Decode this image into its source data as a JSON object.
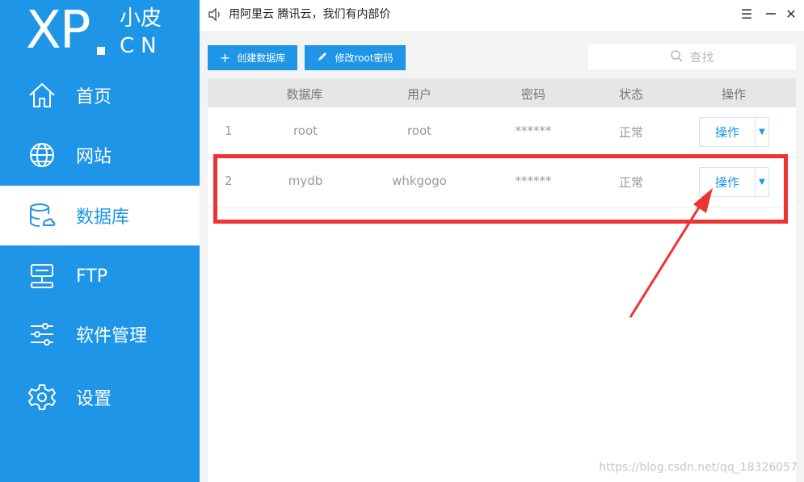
{
  "logo": {
    "main": "XP",
    "cn_top": "小皮",
    "cn_bottom": "CN"
  },
  "nav": [
    {
      "label": "首页",
      "icon": "home-icon"
    },
    {
      "label": "网站",
      "icon": "globe-icon"
    },
    {
      "label": "数据库",
      "icon": "database-icon",
      "active": true
    },
    {
      "label": "FTP",
      "icon": "server-icon"
    },
    {
      "label": "软件管理",
      "icon": "sliders-icon"
    },
    {
      "label": "设置",
      "icon": "gear-icon"
    }
  ],
  "topbar": {
    "notice": "用阿里云 腾讯云，我们有内部价",
    "minimize": "☰",
    "close": "✕"
  },
  "toolbar": {
    "create_label": "创建数据库",
    "change_pwd_label": "修改root密码",
    "search_placeholder": "查找"
  },
  "table": {
    "headers": [
      "数据库",
      "用户",
      "密码",
      "状态",
      "操作"
    ],
    "rows": [
      {
        "index": "1",
        "database": "root",
        "user": "root",
        "password": "******",
        "status": "正常",
        "action": "操作"
      },
      {
        "index": "2",
        "database": "mydb",
        "user": "whkgogo",
        "password": "******",
        "status": "正常",
        "action": "操作"
      }
    ]
  },
  "watermark": "https://blog.csdn.net/qq_18326057",
  "colors": {
    "brand": "#1e95e6",
    "annotation": "#ee3333"
  }
}
